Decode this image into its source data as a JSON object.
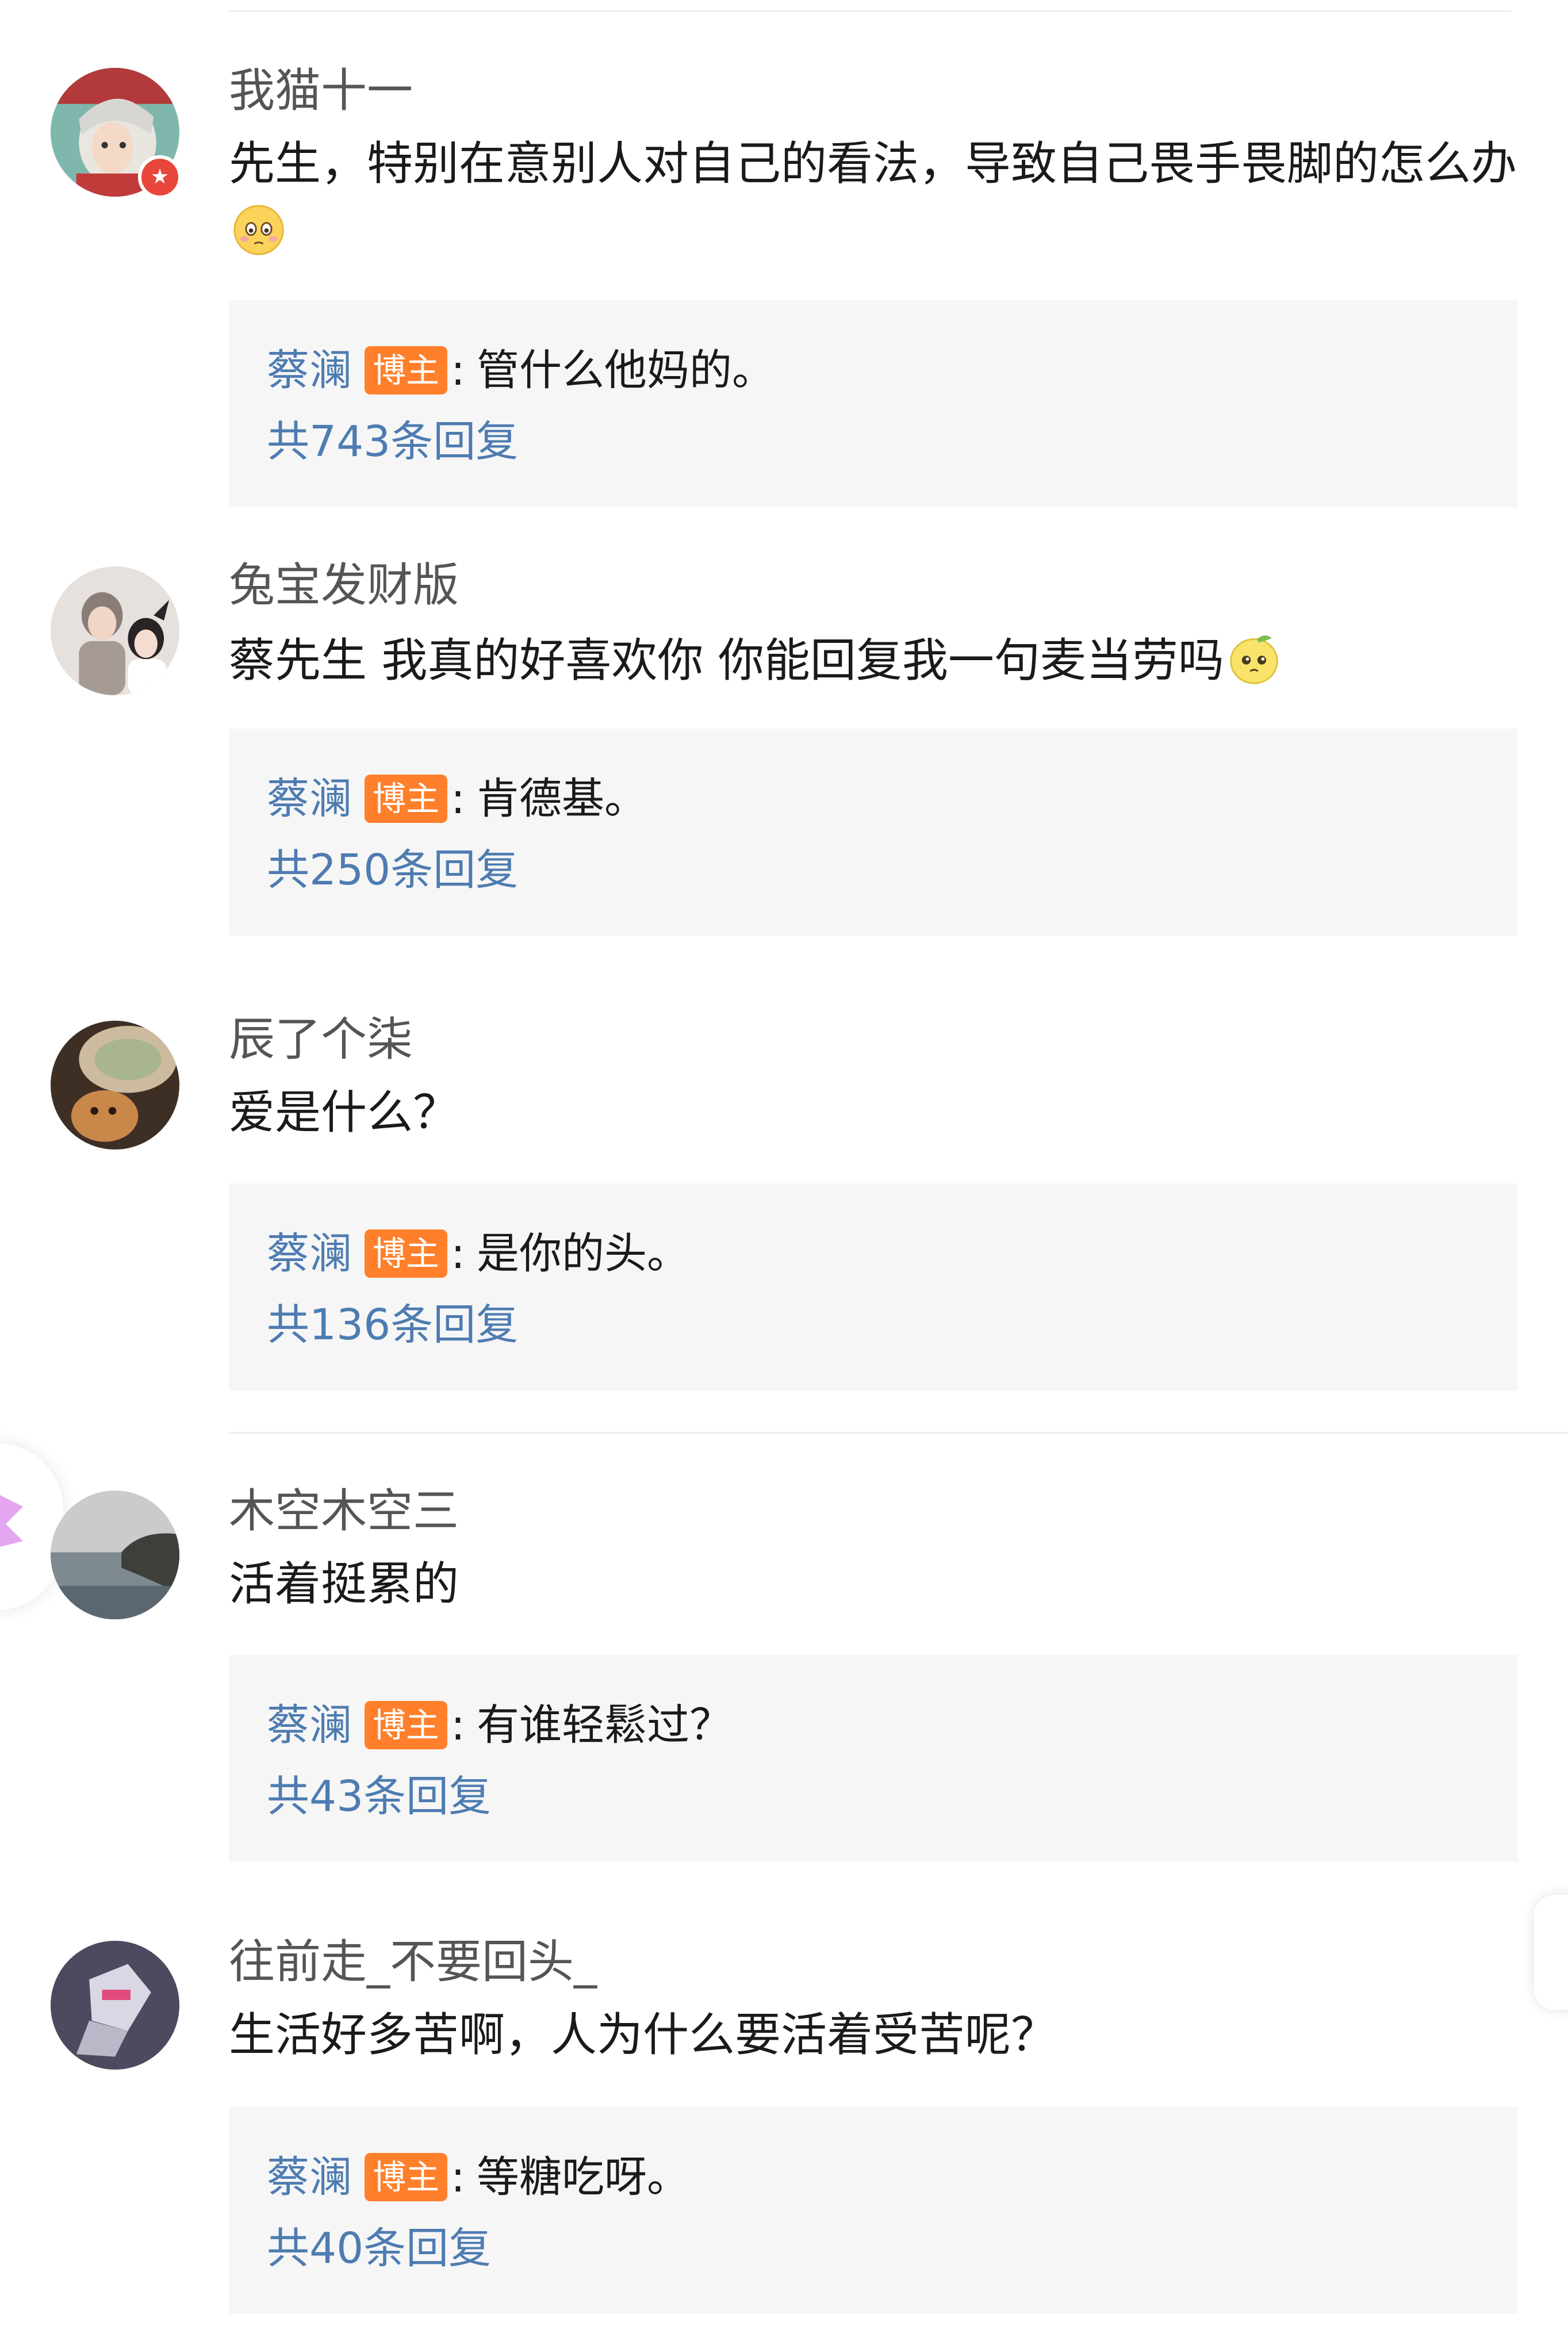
{
  "comments": [
    {
      "username": "我猫十一",
      "text": "先生，特别在意别人对自己的看法，导致自己畏手畏脚的怎么办",
      "emoji": "flushed-face-emoji",
      "avatar": "anime-character-avatar",
      "vip": true,
      "reply": {
        "author": "蔡澜",
        "badge": "博主",
        "text": "管什么他妈的。",
        "count": "共743条回复"
      }
    },
    {
      "username": "兔宝发财版",
      "text": "蔡先生 我真的好喜欢你 你能回复我一句麦当劳吗",
      "emoji": "pleading-lemon-emoji",
      "avatar": "couple-illustration-avatar",
      "vip": false,
      "reply": {
        "author": "蔡澜",
        "badge": "博主",
        "text": "肯德基。",
        "count": "共250条回复"
      }
    },
    {
      "username": "辰了个柒",
      "text": "爱是什么？",
      "emoji": "",
      "avatar": "puppy-photo-avatar",
      "vip": false,
      "reply": {
        "author": "蔡澜",
        "badge": "博主",
        "text": "是你的头。",
        "count": "共136条回复"
      }
    },
    {
      "username": "木空木空三",
      "text": "活着挺累的",
      "emoji": "",
      "avatar": "seaside-landscape-avatar",
      "vip": false,
      "reply": {
        "author": "蔡澜",
        "badge": "博主",
        "text": "有谁轻鬆过？",
        "count": "共43条回复"
      }
    },
    {
      "username": "往前走_不要回头_",
      "text": "生活好多苦啊，人为什么要活着受苦呢？",
      "emoji": "",
      "avatar": "robot-character-avatar",
      "vip": false,
      "reply": {
        "author": "蔡澜",
        "badge": "博主",
        "text": "等糖吃呀。",
        "count": "共40条回复"
      }
    }
  ],
  "colors": {
    "link_blue": "#4e7cb1",
    "host_badge_orange": "#ff7f2a",
    "reply_bg": "#f6f6f6",
    "username_gray": "#555555",
    "text_black": "#1a1a1a",
    "vip_red": "#e8463a"
  }
}
